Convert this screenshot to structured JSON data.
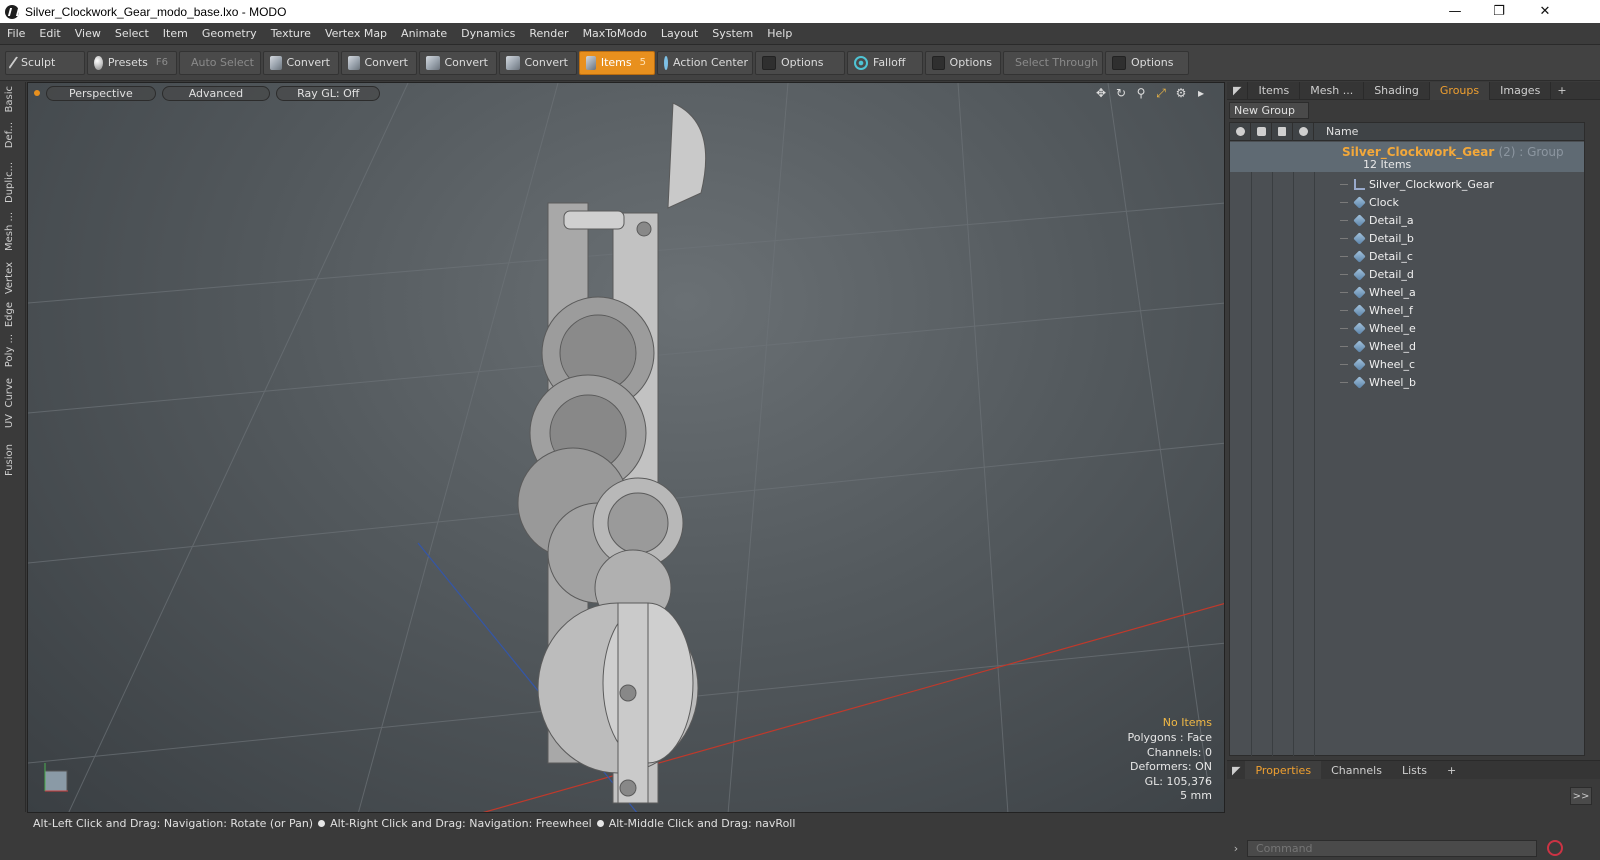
{
  "window": {
    "title": "Silver_Clockwork_Gear_modo_base.lxo - MODO",
    "minimize": "—",
    "maximize": "❐",
    "close": "✕"
  },
  "menu": [
    "File",
    "Edit",
    "View",
    "Select",
    "Item",
    "Geometry",
    "Texture",
    "Vertex Map",
    "Animate",
    "Dynamics",
    "Render",
    "MaxToModo",
    "Layout",
    "System",
    "Help"
  ],
  "toolbar": {
    "sculpt": "Sculpt",
    "presets": "Presets",
    "presets_key": "F6",
    "auto_select": "Auto Select",
    "convert1": "Convert",
    "convert2": "Convert",
    "convert3": "Convert",
    "convert4": "Convert",
    "items": "Items",
    "items_key": "5",
    "action_center": "Action Center",
    "options1": "Options",
    "falloff": "Falloff",
    "options2": "Options",
    "select_through": "Select Through",
    "options3": "Options"
  },
  "left_tabs": [
    "Basic",
    "Def...",
    "Duplic...",
    "Mesh ...",
    "Vertex",
    "Edge",
    "Poly ...",
    "Curve",
    "UV",
    "Fusion"
  ],
  "viewport": {
    "view": "Perspective",
    "shading": "Advanced",
    "raygl": "Ray GL: Off",
    "info": {
      "selection": "No Items",
      "polygons": "Polygons : Face",
      "channels": "Channels: 0",
      "deformers": "Deformers: ON",
      "gl": "GL: 105,376",
      "unit": "5 mm"
    }
  },
  "right_panel": {
    "tabs": [
      "Items",
      "Mesh ...",
      "Shading",
      "Groups",
      "Images"
    ],
    "active_tab": "Groups",
    "new_group": "New Group",
    "column_name": "Name",
    "group": {
      "name": "Silver_Clockwork_Gear",
      "suffix": "(2) : Group",
      "count": "12 Items"
    },
    "items": [
      "Silver_Clockwork_Gear",
      "Clock",
      "Detail_a",
      "Detail_b",
      "Detail_c",
      "Detail_d",
      "Wheel_a",
      "Wheel_f",
      "Wheel_e",
      "Wheel_d",
      "Wheel_c",
      "Wheel_b"
    ]
  },
  "bottom_panel": {
    "tabs": [
      "Properties",
      "Channels",
      "Lists"
    ],
    "expand": ">>"
  },
  "status": {
    "hint1": "Alt-Left Click and Drag: Navigation: Rotate (or Pan)",
    "hint2": "Alt-Right Click and Drag: Navigation: Freewheel",
    "hint3": "Alt-Middle Click and Drag: navRoll"
  },
  "command": {
    "placeholder": "Command"
  }
}
